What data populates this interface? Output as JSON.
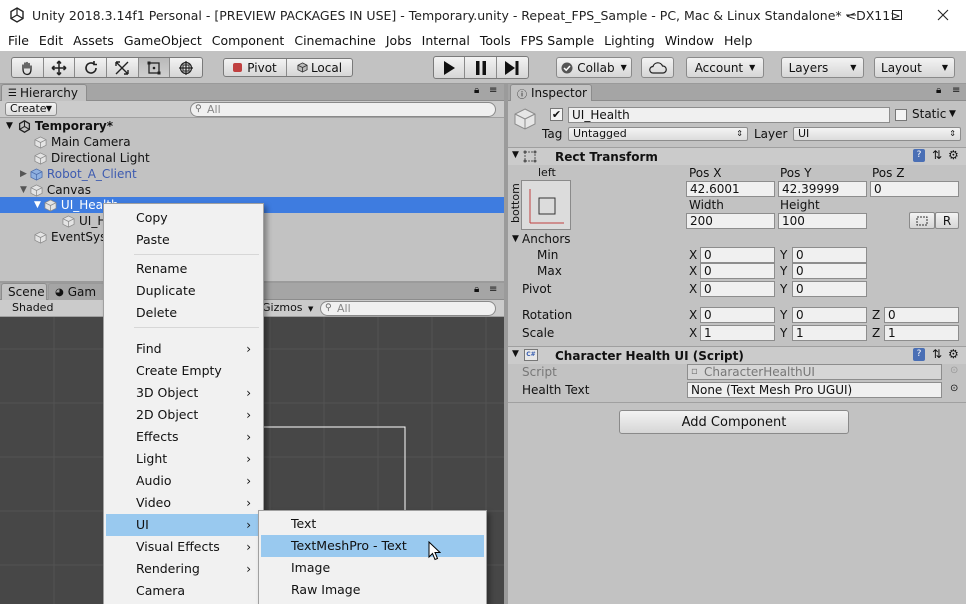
{
  "window": {
    "title": "Unity 2018.3.14f1 Personal - [PREVIEW PACKAGES IN USE] - Temporary.unity - Repeat_FPS_Sample - PC, Mac & Linux Standalone* <DX11>"
  },
  "menubar": [
    "File",
    "Edit",
    "Assets",
    "GameObject",
    "Component",
    "Cinemachine",
    "Jobs",
    "Internal",
    "Tools",
    "FPS Sample",
    "Lighting",
    "Window",
    "Help"
  ],
  "toolbar": {
    "pivot": "Pivot",
    "local": "Local",
    "collab": "Collab",
    "account": "Account",
    "layers": "Layers",
    "layout": "Layout"
  },
  "hierarchy": {
    "tab": "Hierarchy",
    "create": "Create",
    "search_placeholder": "All",
    "scene": "Temporary*",
    "items": [
      "Main Camera",
      "Directional Light",
      "Robot_A_Client",
      "Canvas",
      "UI_Health",
      "UI_H",
      "EventSys"
    ]
  },
  "scene": {
    "tab_scene": "Scene",
    "tab_game": "Gam",
    "shaded": "Shaded",
    "gizmos": "Gizmos",
    "search_placeholder": "All"
  },
  "inspector": {
    "tab": "Inspector",
    "object_name": "UI_Health",
    "static": "Static",
    "tag_label": "Tag",
    "tag_value": "Untagged",
    "layer_label": "Layer",
    "layer_value": "UI",
    "rect_transform": {
      "title": "Rect Transform",
      "anchor_top": "left",
      "anchor_side": "bottom",
      "pos_x_label": "Pos X",
      "pos_y_label": "Pos Y",
      "pos_z_label": "Pos Z",
      "pos_x": "42.6001",
      "pos_y": "42.39999",
      "pos_z": "0",
      "width_label": "Width",
      "height_label": "Height",
      "width": "200",
      "height": "100",
      "r_button": "R",
      "anchors": "Anchors",
      "min": "Min",
      "max": "Max",
      "min_x": "0",
      "min_y": "0",
      "max_x": "0",
      "max_y": "0",
      "pivot": "Pivot",
      "pivot_x": "0",
      "pivot_y": "0",
      "rotation": "Rotation",
      "rot_x": "0",
      "rot_y": "0",
      "rot_z": "0",
      "scale": "Scale",
      "scale_x": "1",
      "scale_y": "1",
      "scale_z": "1",
      "x": "X",
      "y": "Y",
      "z": "Z"
    },
    "script_component": {
      "title": "Character Health UI (Script)",
      "script_label": "Script",
      "script_value": "CharacterHealthUI",
      "health_text_label": "Health Text",
      "health_text_value": "None (Text Mesh Pro UGUI)"
    },
    "add_component": "Add Component"
  },
  "context_menu": {
    "group1": [
      "Copy",
      "Paste"
    ],
    "group2": [
      "Rename",
      "Duplicate",
      "Delete"
    ],
    "group3": [
      "Find",
      "Create Empty",
      "3D Object",
      "2D Object",
      "Effects",
      "Light",
      "Audio",
      "Video",
      "UI",
      "Visual Effects",
      "Rendering",
      "Camera"
    ]
  },
  "ui_submenu": [
    "Text",
    "TextMeshPro - Text",
    "Image",
    "Raw Image"
  ],
  "colors": {
    "selection": "#3e7ce0",
    "menu_highlight": "#99c9ef",
    "prefab_text": "#3d5bb0"
  }
}
